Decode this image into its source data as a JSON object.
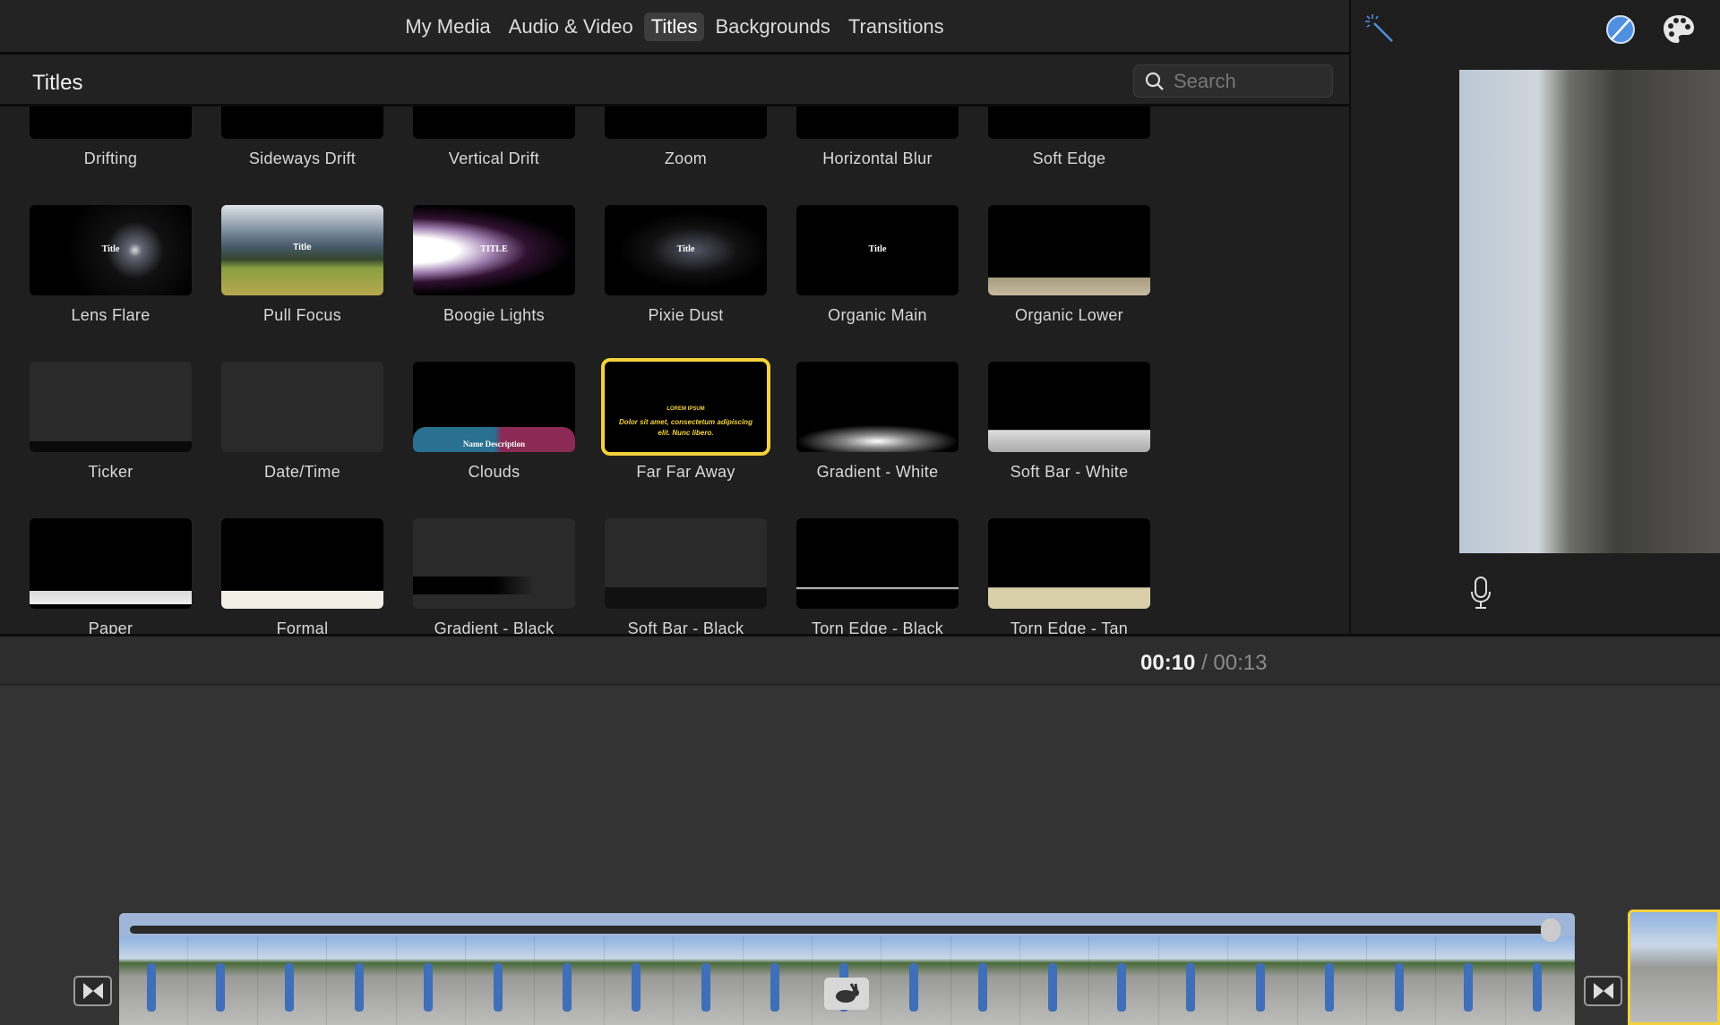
{
  "tabs": [
    {
      "label": "My Media"
    },
    {
      "label": "Audio & Video"
    },
    {
      "label": "Titles",
      "active": true
    },
    {
      "label": "Backgrounds"
    },
    {
      "label": "Transitions"
    }
  ],
  "header": {
    "title": "Titles"
  },
  "search": {
    "placeholder": "Search",
    "value": ""
  },
  "selected_title": "Far Far Away",
  "accent_color": "#f4d23c",
  "titles": [
    {
      "label": "Drifting",
      "thumb": "black"
    },
    {
      "label": "Sideways Drift",
      "thumb": "black"
    },
    {
      "label": "Vertical Drift",
      "thumb": "black"
    },
    {
      "label": "Zoom",
      "thumb": "black"
    },
    {
      "label": "Horizontal Blur",
      "thumb": "black"
    },
    {
      "label": "Soft Edge",
      "thumb": "black"
    },
    {
      "label": "Lens Flare",
      "thumb": "lensflare",
      "text": "Title"
    },
    {
      "label": "Pull Focus",
      "thumb": "mountain",
      "text": "Title"
    },
    {
      "label": "Boogie Lights",
      "thumb": "boogie",
      "text": "TITLE"
    },
    {
      "label": "Pixie Dust",
      "thumb": "pixie",
      "text": "Title"
    },
    {
      "label": "Organic Main",
      "thumb": "black",
      "text": "Title"
    },
    {
      "label": "Organic Lower",
      "thumb": "organiclower"
    },
    {
      "label": "Ticker",
      "thumb": "ticker"
    },
    {
      "label": "Date/Time",
      "thumb": "datetime"
    },
    {
      "label": "Clouds",
      "thumb": "clouds",
      "text": "Name   Description"
    },
    {
      "label": "Far Far Away",
      "thumb": "farfaraway",
      "text": "LOREM IPSUM",
      "subtext": "Dolor sit amet, consectetum adipiscing elit. Nunc libero."
    },
    {
      "label": "Gradient - White",
      "thumb": "gradwhite"
    },
    {
      "label": "Soft Bar - White",
      "thumb": "softwhite"
    },
    {
      "label": "Paper",
      "thumb": "paper"
    },
    {
      "label": "Formal",
      "thumb": "formal"
    },
    {
      "label": "Gradient - Black",
      "thumb": "gradblack"
    },
    {
      "label": "Soft Bar - Black",
      "thumb": "softblack"
    },
    {
      "label": "Torn Edge - Black",
      "thumb": "tornblack"
    },
    {
      "label": "Torn Edge - Tan",
      "thumb": "torntan"
    }
  ],
  "toolbar_icons": [
    "magic-wand-icon",
    "color-balance-icon",
    "palette-icon"
  ],
  "playback": {
    "current": "00:10",
    "separator": "/",
    "total": "00:13"
  }
}
